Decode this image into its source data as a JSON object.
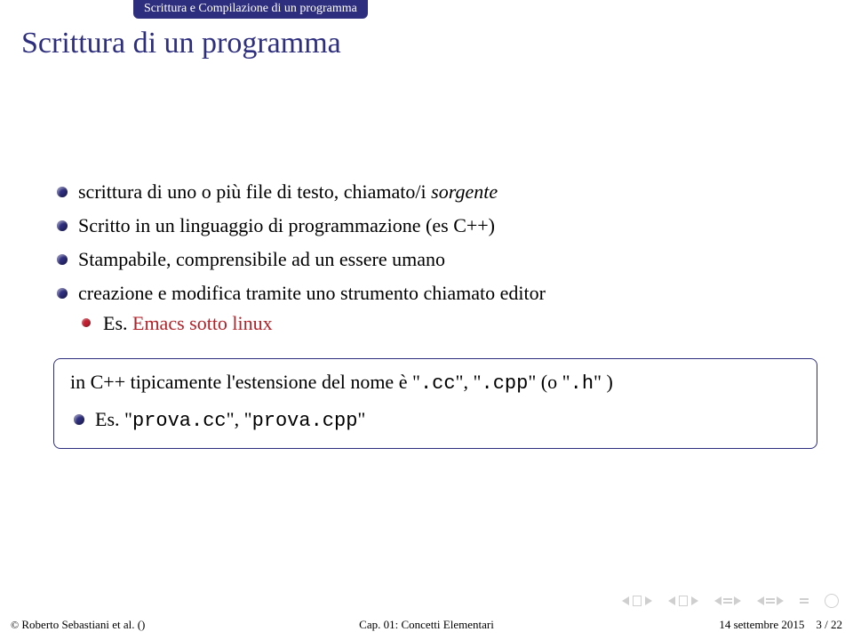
{
  "header": {
    "section": "Scrittura e Compilazione di un programma"
  },
  "title": "Scrittura di un programma",
  "bullets": [
    {
      "text_pre": "scrittura di uno o più file di testo, chiamato/i ",
      "em": "sorgente"
    },
    {
      "text": "Scritto in un linguaggio di programmazione (es C++)"
    },
    {
      "text": "Stampabile, comprensibile ad un essere umano"
    },
    {
      "text": "creazione e modifica tramite uno strumento chiamato editor",
      "sub": {
        "pre": "Es. ",
        "red": "Emacs sotto linux"
      }
    }
  ],
  "block": {
    "line1_a": "in C++ tipicamente l'estensione del nome è \"",
    "line1_cc": ".cc",
    "line1_b": "\", \"",
    "line1_cpp": ".cpp",
    "line1_c": "\" (o \"",
    "line1_h": ".h",
    "line1_d": "\" )",
    "item_pre": "Es. \"",
    "item_m1": "prova.cc",
    "item_mid": "\", \"",
    "item_m2": "prova.cpp",
    "item_post": "\""
  },
  "footer": {
    "left_copyright": "©",
    "left_author": " Roberto Sebastiani et al. ()",
    "center": "Cap. 01: Concetti Elementari",
    "right_date": "14 settembre 2015",
    "right_page": "3 / 22"
  }
}
